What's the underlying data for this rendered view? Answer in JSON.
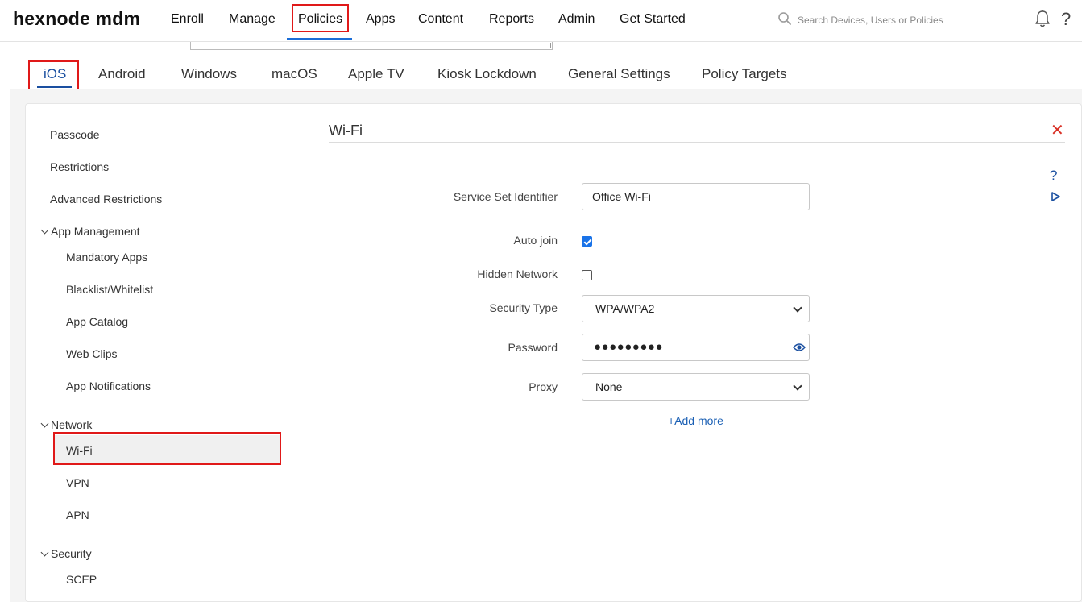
{
  "app": {
    "logo": "hexnode mdm"
  },
  "nav": {
    "items": [
      "Enroll",
      "Manage",
      "Policies",
      "Apps",
      "Content",
      "Reports",
      "Admin",
      "Get Started"
    ],
    "active": "Policies"
  },
  "search": {
    "placeholder": "Search Devices, Users or Policies"
  },
  "header_icons": {
    "help": "?"
  },
  "platform_tabs": {
    "items": [
      "iOS",
      "Android",
      "Windows",
      "macOS",
      "Apple TV",
      "Kiosk Lockdown",
      "General Settings",
      "Policy Targets"
    ],
    "active": "iOS"
  },
  "sidebar": {
    "top_items": [
      "Passcode",
      "Restrictions",
      "Advanced Restrictions"
    ],
    "groups": [
      {
        "label": "App Management",
        "items": [
          "Mandatory Apps",
          "Blacklist/Whitelist",
          "App Catalog",
          "Web Clips",
          "App Notifications"
        ]
      },
      {
        "label": "Network",
        "items": [
          "Wi-Fi",
          "VPN",
          "APN"
        ]
      },
      {
        "label": "Security",
        "items": [
          "SCEP"
        ]
      }
    ],
    "selected": "Wi-Fi"
  },
  "form": {
    "title": "Wi-Fi",
    "close": "✕",
    "ssid_label": "Service Set Identifier",
    "ssid_value": "Office Wi-Fi",
    "auto_join_label": "Auto join",
    "auto_join_checked": true,
    "hidden_network_label": "Hidden Network",
    "hidden_network_checked": false,
    "security_type_label": "Security Type",
    "security_type_value": "WPA/WPA2",
    "password_label": "Password",
    "password_masked": "●●●●●●●●●",
    "proxy_label": "Proxy",
    "proxy_value": "None",
    "add_more": "+Add more"
  },
  "side_help": {
    "help": "?"
  },
  "colors": {
    "accent": "#1a4fa0",
    "highlight_box": "#e01919",
    "close": "#d93025"
  },
  "icons": [
    "search-icon",
    "bell-icon",
    "help-icon",
    "eye-icon",
    "play-icon",
    "chevron-down-icon"
  ]
}
